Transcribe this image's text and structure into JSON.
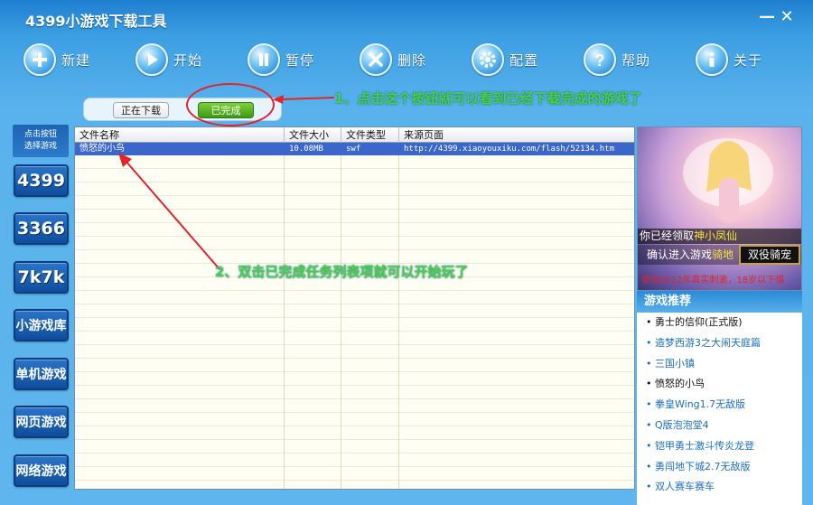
{
  "app": {
    "title": "4399小游戏下载工具",
    "min_label": "—",
    "close_label": "✕"
  },
  "toolbar": {
    "items": [
      {
        "label": "新建",
        "icon": "plus-icon"
      },
      {
        "label": "开始",
        "icon": "play-icon"
      },
      {
        "label": "暂停",
        "icon": "pause-icon"
      },
      {
        "label": "删除",
        "icon": "delete-icon"
      },
      {
        "label": "配置",
        "icon": "gear-icon"
      },
      {
        "label": "帮助",
        "icon": "help-icon"
      },
      {
        "label": "关于",
        "icon": "info-icon"
      }
    ]
  },
  "tabs": {
    "downloading": "正在下载",
    "completed": "已完成",
    "active": "completed"
  },
  "annotations": {
    "step1": "1、点击这个按钮就可以看到已经下载完成的游戏了",
    "step2": "2、双击已完成任务列表项就可以开始玩了",
    "color": "#4dd13a",
    "marker_color": "#e2232a"
  },
  "sidebar": {
    "header_line1": "点击按钮",
    "header_line2": "选择游戏",
    "items": [
      "4399",
      "3366",
      "7k7k",
      "小游戏库",
      "单机游戏",
      "网页游戏",
      "网络游戏"
    ]
  },
  "table": {
    "columns": [
      "文件名称",
      "文件大小",
      "文件类型",
      "来源页面"
    ],
    "rows": [
      {
        "name": "愤怒的小鸟",
        "size": "10.08MB",
        "type": "swf",
        "source": "http://4399.xiaoyouxiku.com/flash/52134.htm",
        "selected": true
      }
    ]
  },
  "ad": {
    "line1_prefix": "你已经领取",
    "line1_highlight": "神小凤仙",
    "line2_prefix": "确认进入游戏",
    "line2_highlight": "骑地",
    "button": "双役骑宠",
    "line3": "参加2012年真实刺激，18岁以下慎"
  },
  "recommend": {
    "title": "游戏推荐",
    "items": [
      {
        "label": "勇士的信仰(正式版)",
        "link": false
      },
      {
        "label": "造梦西游3之大闹天庭篇",
        "link": true
      },
      {
        "label": "三国小镇",
        "link": true
      },
      {
        "label": "愤怒的小鸟",
        "link": false
      },
      {
        "label": "拳皇Wing1.7无敌版",
        "link": true
      },
      {
        "label": "Q版泡泡堂4",
        "link": true
      },
      {
        "label": "铠甲勇士激斗传炎龙登",
        "link": true
      },
      {
        "label": "勇闯地下城2.7无敌版",
        "link": true
      },
      {
        "label": "双人赛车赛车",
        "link": true
      }
    ]
  },
  "colors": {
    "selection": "#3a67c9",
    "accent": "#2f8fd8",
    "tab_active": "#3c9a14"
  }
}
